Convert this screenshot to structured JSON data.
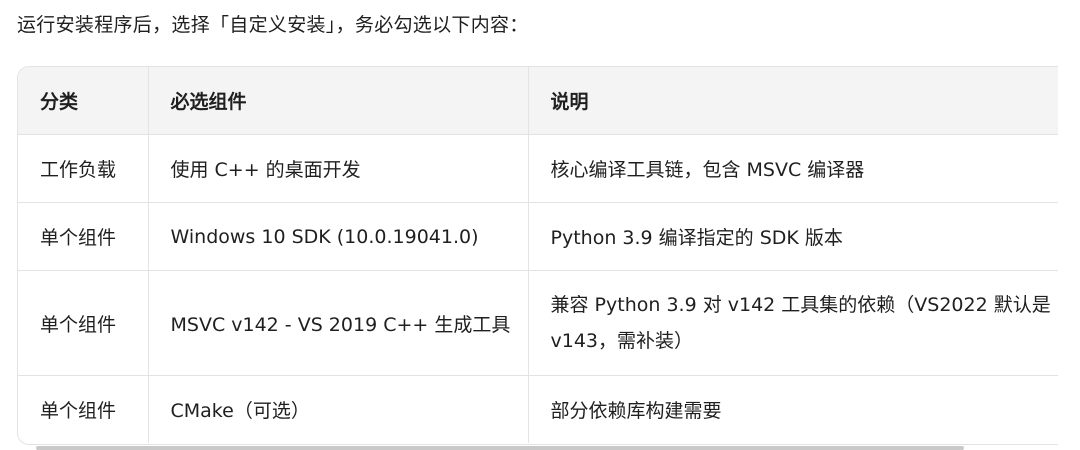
{
  "intro_text": "运行安装程序后，选择「自定义安装」，务必勾选以下内容：",
  "table": {
    "headers": [
      "分类",
      "必选组件",
      "说明"
    ],
    "rows": [
      [
        "工作负载",
        "使用 C++ 的桌面开发",
        "核心编译工具链，包含 MSVC 编译器"
      ],
      [
        "单个组件",
        "Windows 10 SDK (10.0.19041.0)",
        "Python 3.9 编译指定的 SDK 版本"
      ],
      [
        "单个组件",
        "MSVC v142 - VS 2019 C++ 生成工具",
        "兼容 Python 3.9 对 v142 工具集的依赖（VS2022 默认是 v143，需补装）"
      ],
      [
        "单个组件",
        "CMake（可选）",
        "部分依赖库构建需要"
      ]
    ]
  }
}
